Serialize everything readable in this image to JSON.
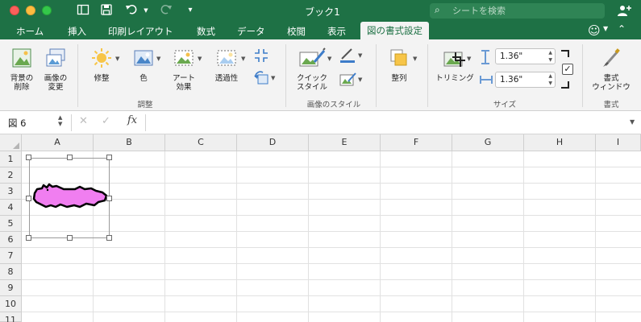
{
  "titlebar": {
    "title": "ブック1",
    "search_placeholder": "シートを検索",
    "accent": "#1e7145"
  },
  "tabs": [
    {
      "label": "ホーム"
    },
    {
      "label": "挿入"
    },
    {
      "label": "印刷レイアウト"
    },
    {
      "label": "数式"
    },
    {
      "label": "データ"
    },
    {
      "label": "校閲"
    },
    {
      "label": "表示"
    },
    {
      "label": "図の書式設定",
      "active": true
    }
  ],
  "ribbon": {
    "remove_bg": "背景の\n削除",
    "change_picture": "画像の\n変更",
    "corrections": "修整",
    "color": "色",
    "art_effects": "アート\n効果",
    "transparency": "透過性",
    "group_adjust": "調整",
    "quick_styles": "クイック\nスタイル",
    "group_styles": "画像のスタイル",
    "arrange": "整列",
    "crop": "トリミング",
    "height": "1.36\"",
    "width": "1.36\"",
    "group_size": "サイズ",
    "format_pane": "書式\nウィンドウ",
    "group_format": "書式",
    "lock_aspect_checked": true
  },
  "formula_bar": {
    "name_box": "図 6",
    "fx": "fx",
    "formula": ""
  },
  "grid": {
    "columns": [
      "A",
      "B",
      "C",
      "D",
      "E",
      "F",
      "G",
      "H",
      "I"
    ],
    "rows": [
      "1",
      "2",
      "3",
      "4",
      "5",
      "6",
      "7",
      "8",
      "9",
      "10",
      "11"
    ]
  },
  "picture": {
    "fill": "#f07ef0",
    "name": "図 6"
  }
}
